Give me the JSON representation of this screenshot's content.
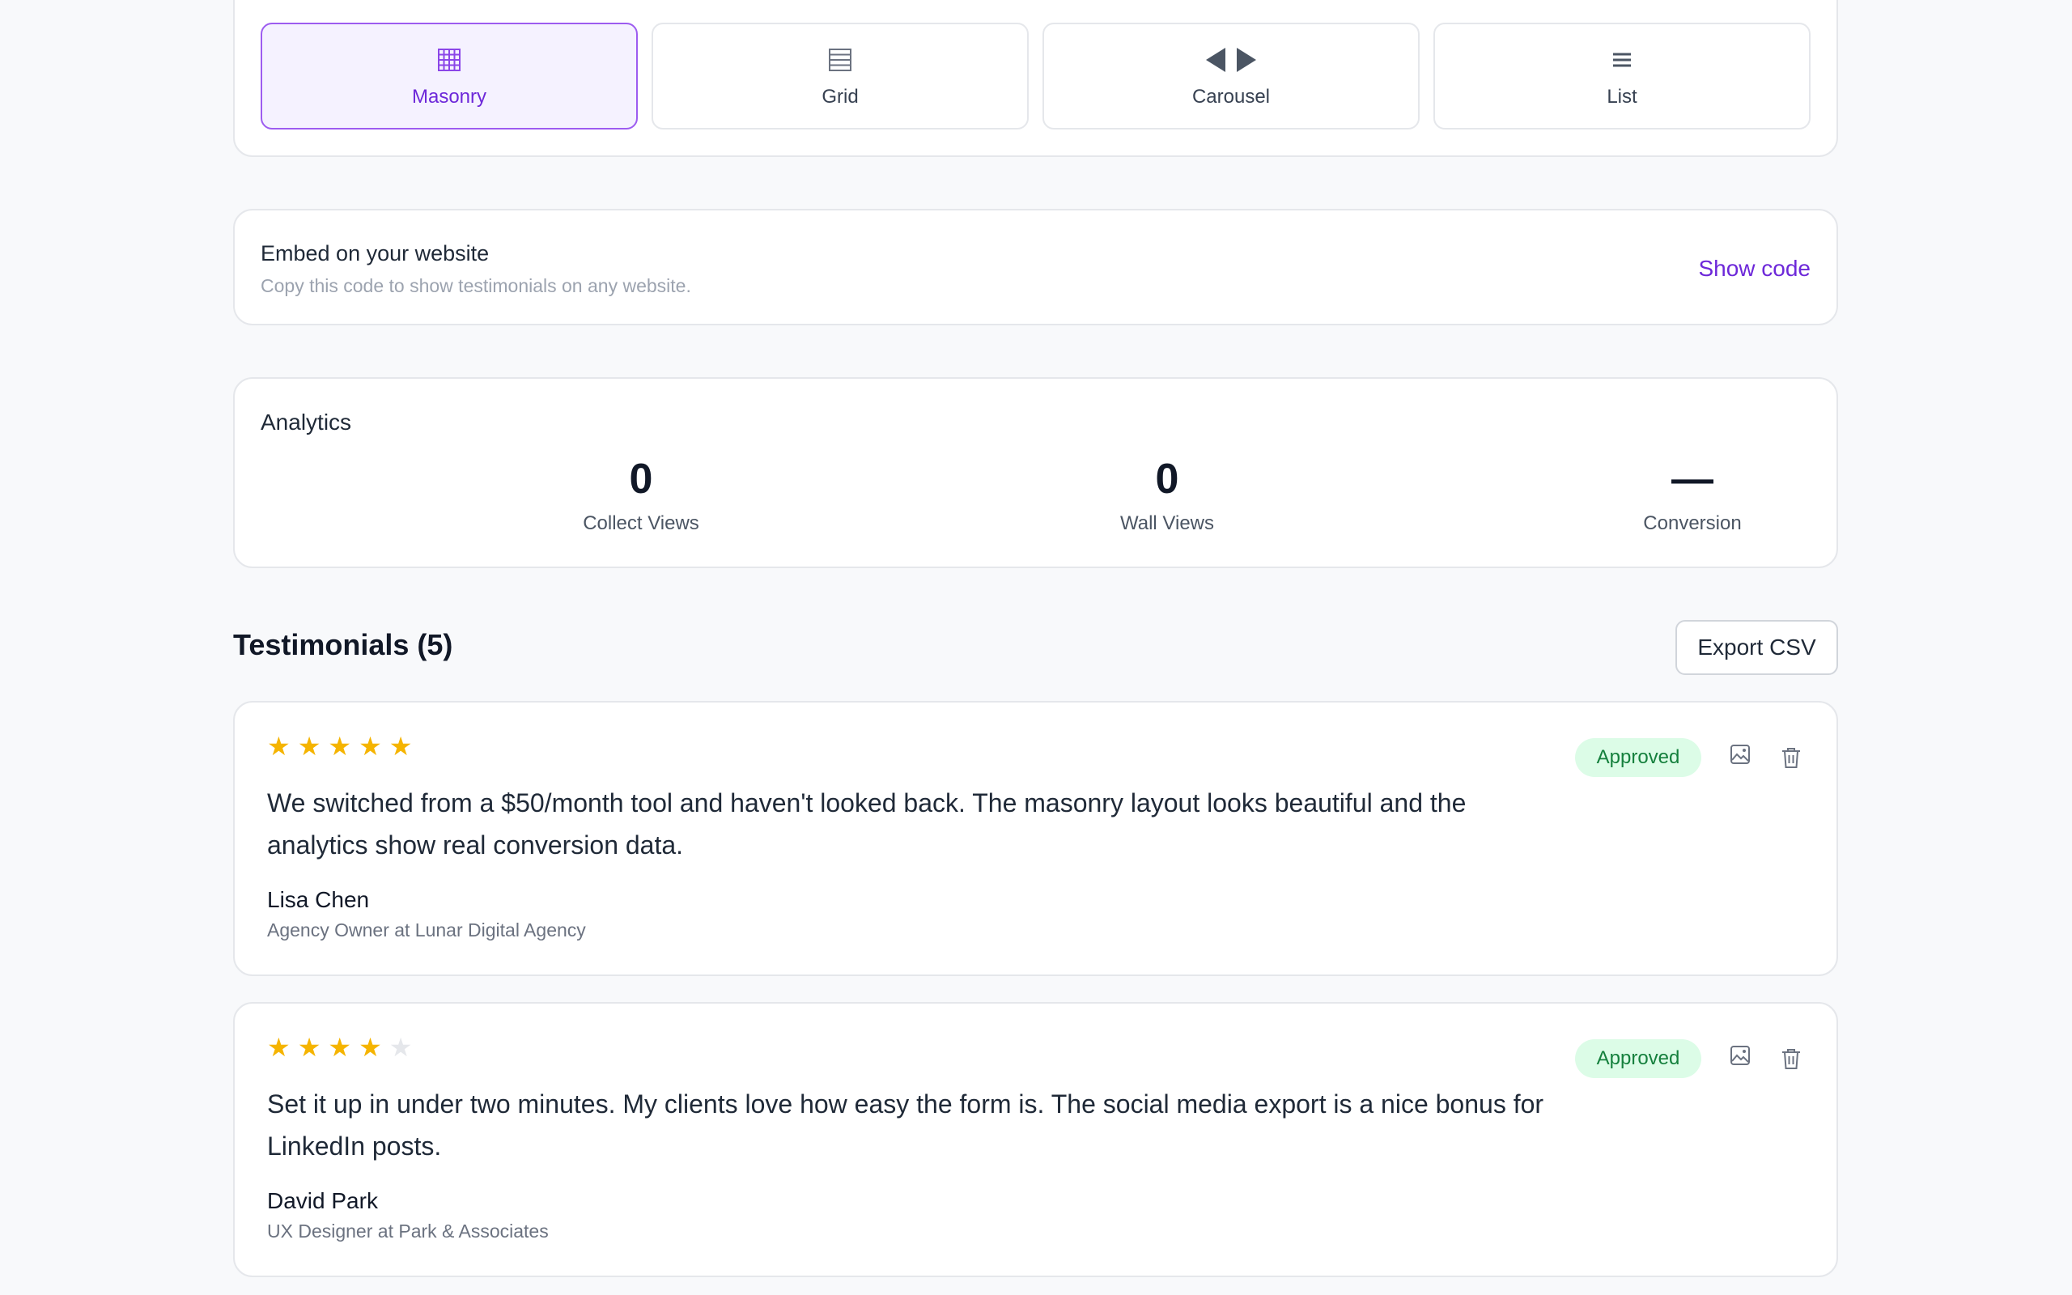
{
  "layouts": [
    {
      "label": "Masonry",
      "icon": "masonry-grid-icon",
      "active": true
    },
    {
      "label": "Grid",
      "icon": "grid-icon",
      "active": false
    },
    {
      "label": "Carousel",
      "icon": "carousel-arrows-icon",
      "active": false
    },
    {
      "label": "List",
      "icon": "list-icon",
      "active": false
    }
  ],
  "embed": {
    "title": "Embed on your website",
    "subtitle": "Copy this code to show testimonials on any website.",
    "show_code": "Show code"
  },
  "analytics": {
    "title": "Analytics",
    "stats": [
      {
        "value": "0",
        "label": "Collect Views"
      },
      {
        "value": "0",
        "label": "Wall Views"
      },
      {
        "value": "—",
        "label": "Conversion"
      }
    ]
  },
  "testimonials_header": {
    "title": "Testimonials (5)",
    "export_label": "Export CSV"
  },
  "testimonials": [
    {
      "rating": 5,
      "text": "We switched from a $50/month tool and haven't looked back. The masonry layout looks beautiful and the analytics show real conversion data.",
      "author": "Lisa Chen",
      "role": "Agency Owner at Lunar Digital Agency",
      "status": "Approved"
    },
    {
      "rating": 4,
      "text": "Set it up in under two minutes. My clients love how easy the form is. The social media export is a nice bonus for LinkedIn posts.",
      "author": "David Park",
      "role": "UX Designer at Park & Associates",
      "status": "Approved"
    }
  ],
  "colors": {
    "accent": "#6d28d9",
    "star": "#f5b400",
    "approved_bg": "#dcfce7",
    "approved_text": "#15803d"
  }
}
